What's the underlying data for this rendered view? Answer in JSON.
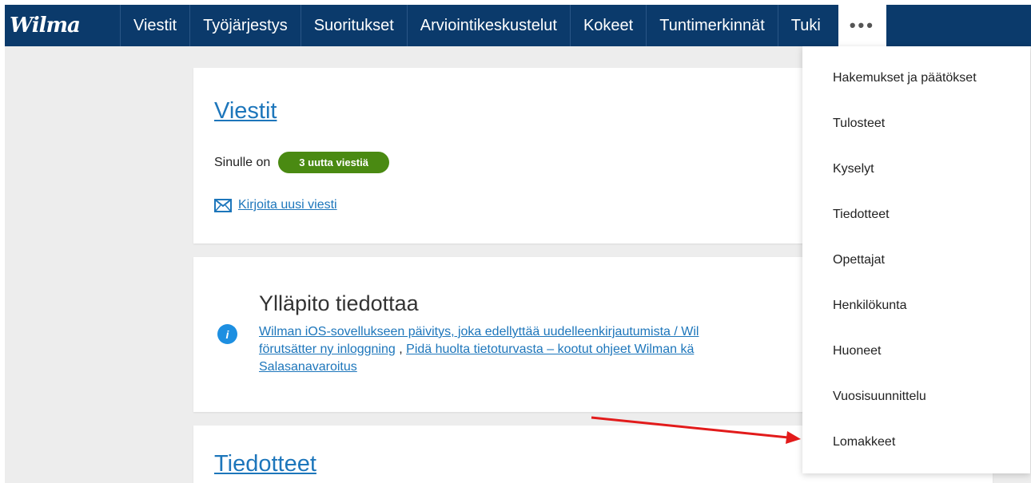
{
  "brand": {
    "logo_text": "Wilma"
  },
  "nav": {
    "items": [
      "Viestit",
      "Työjärjestys",
      "Suoritukset",
      "Arviointikeskustelut",
      "Kokeet",
      "Tuntimerkinnät",
      "Tuki"
    ],
    "more_label": "•••"
  },
  "messages_card": {
    "title": "Viestit",
    "prefix": "Sinulle on",
    "badge": "3 uutta viestiä",
    "new_message_link": "Kirjoita uusi viesti"
  },
  "notice_card": {
    "title": "Ylläpito tiedottaa",
    "link1": "Wilman iOS-sovellukseen päivitys, joka edellyttää uudelleenkirjautumista / Wil",
    "link1b": "förutsätter ny inloggning",
    "separator": ",",
    "link2": "Pidä huolta tietoturvasta – kootut ohjeet Wilman kä",
    "link3": "Salasanavaroitus"
  },
  "notices_card": {
    "title": "Tiedotteet"
  },
  "dropdown": {
    "items": [
      "Hakemukset ja päätökset",
      "Tulosteet",
      "Kyselyt",
      "Tiedotteet",
      "Opettajat",
      "Henkilökunta",
      "Huoneet",
      "Vuosisuunnittelu",
      "Lomakkeet"
    ]
  },
  "colors": {
    "nav_bg": "#0b3a6b",
    "link": "#1d76bb",
    "badge": "#4a8a12",
    "arrow": "#e21b1b"
  }
}
